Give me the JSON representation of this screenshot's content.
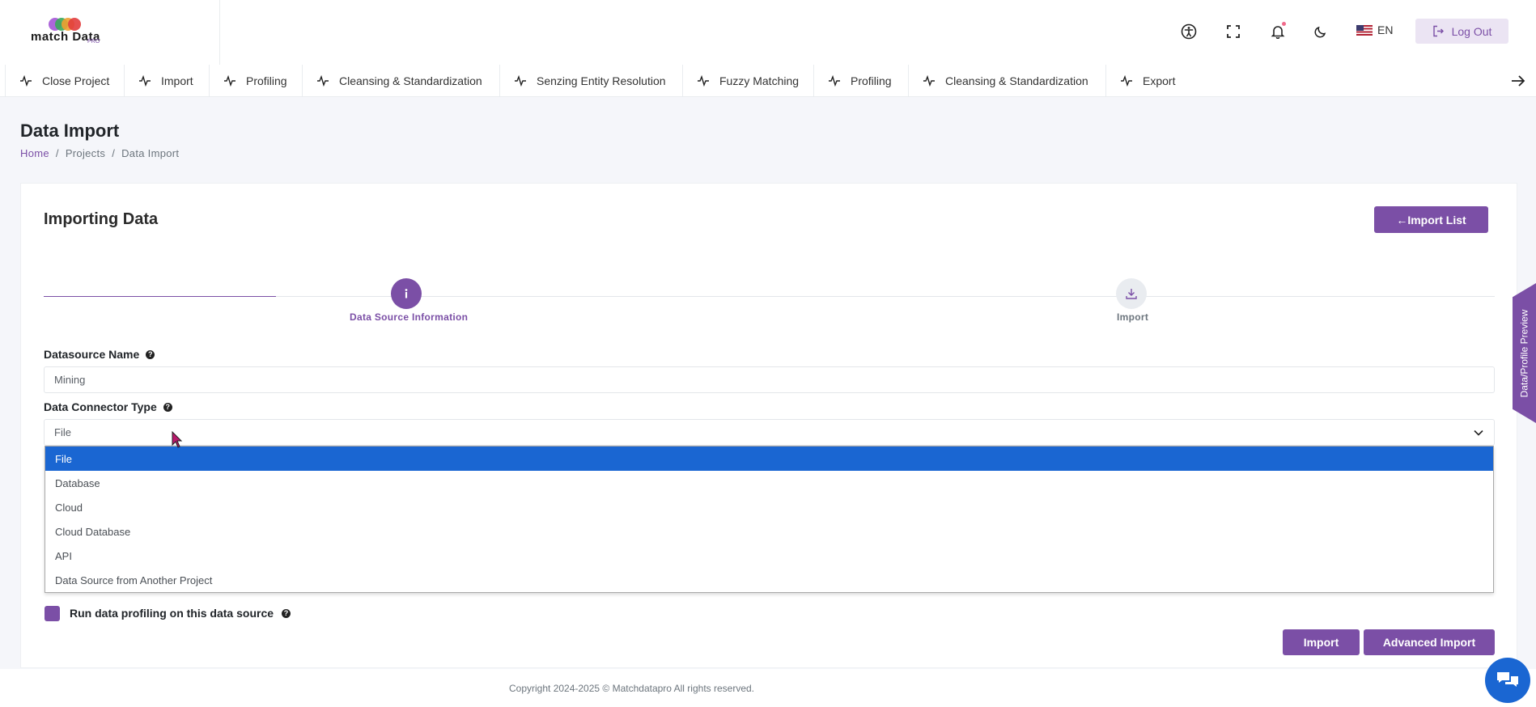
{
  "header": {
    "logo_text": "match Data",
    "logo_sub": "PRO",
    "lang": "EN",
    "logout_label": "Log Out"
  },
  "nav": {
    "tabs": [
      "Close Project",
      "Import",
      "Profiling",
      "Cleansing & Standardization",
      "Senzing Entity Resolution",
      "Fuzzy Matching",
      "Profiling",
      "Cleansing & Standardization",
      "Export"
    ]
  },
  "page": {
    "title": "Data Import",
    "breadcrumb": [
      "Home",
      "/",
      "Projects",
      "/",
      "Data Import"
    ]
  },
  "card": {
    "title": "Importing Data",
    "import_list_label": "←Import List",
    "steps": [
      {
        "label": "Data Source Information",
        "icon": "info-icon",
        "active": true
      },
      {
        "label": "Import",
        "icon": "download-icon",
        "active": false
      }
    ]
  },
  "form": {
    "datasource_name_label": "Datasource Name",
    "datasource_name_value": "Mining",
    "connector_type_label": "Data Connector Type",
    "connector_type_value": "File",
    "connector_options": [
      "File",
      "Database",
      "Cloud",
      "Cloud Database",
      "API",
      "Data Source from Another Project"
    ],
    "selected_option": "File",
    "profiling_checkbox_label": "Run data profiling on this data source",
    "profiling_checked": true,
    "import_label": "Import",
    "advanced_import_label": "Advanced Import"
  },
  "side_tab": "Data/Profile Preview",
  "footer": {
    "copyright": "Copyright 2024-2025 © Matchdatapro All rights reserved."
  },
  "colors": {
    "accent": "#7b4fa6",
    "selected_option": "#1a66d2",
    "chat": "#1a66d2"
  }
}
